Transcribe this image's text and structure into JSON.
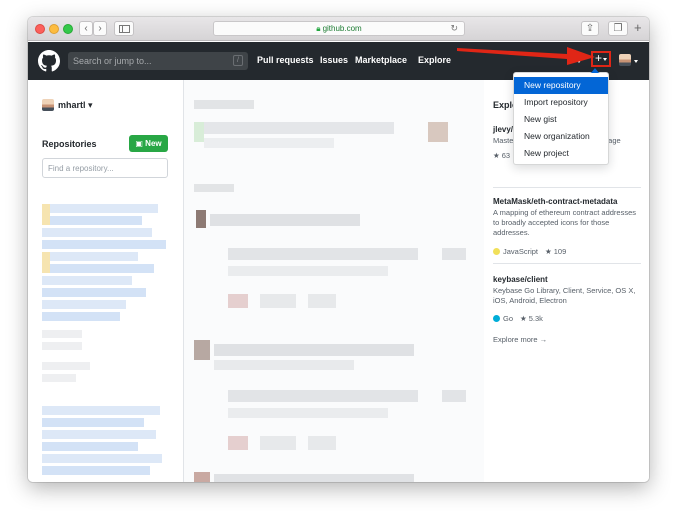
{
  "browser": {
    "address": "github.com"
  },
  "header": {
    "search_placeholder": "Search or jump to...",
    "search_key": "/",
    "nav": [
      "Pull requests",
      "Issues",
      "Marketplace",
      "Explore"
    ],
    "plus_label": "+"
  },
  "dropdown": {
    "items": [
      "New repository",
      "Import repository",
      "New gist",
      "New organization",
      "New project"
    ],
    "active_index": 0
  },
  "sidebar": {
    "username": "mhartl",
    "repositories_heading": "Repositories",
    "new_button": "New",
    "find_placeholder": "Find a repository..."
  },
  "explore": {
    "title_visible": "Explo",
    "repos": [
      {
        "name": "jlevy/t",
        "description": "Maste",
        "desc_tail": "page",
        "stars": "63"
      },
      {
        "name": "MetaMask/eth-contract-metadata",
        "description": "A mapping of ethereum contract addresses to broadly accepted icons for those addresses.",
        "language": "JavaScript",
        "language_color": "#f1e05a",
        "stars": "109"
      },
      {
        "name": "keybase/client",
        "description": "Keybase Go Library, Client, Service, OS X, iOS, Android, Electron",
        "language": "Go",
        "language_color": "#00add8",
        "stars": "5.3k"
      }
    ],
    "more_link": "Explore more →"
  },
  "colors": {
    "header_bg": "#24292e",
    "accent_blue": "#0366d6",
    "new_button": "#28a745",
    "annotation": "#e02616"
  }
}
